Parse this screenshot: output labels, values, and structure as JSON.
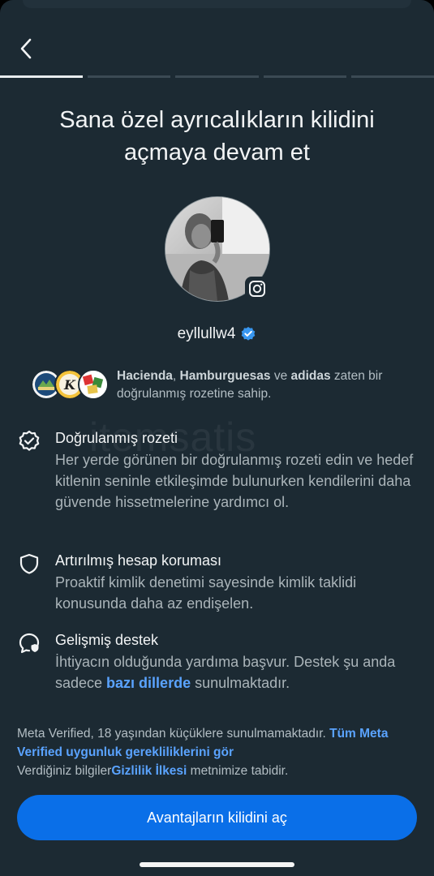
{
  "header": {
    "back_label": "Back",
    "progress": {
      "total_steps": 5,
      "current_step": 1
    }
  },
  "title_line1": "Sana özel ayrıcalıkların kilidini",
  "title_line2": "açmaya devam et",
  "profile": {
    "username": "eyllullw4",
    "verified": true,
    "platform_icon": "instagram-icon"
  },
  "brands": {
    "name1": "Hacienda",
    "sep": ", ",
    "name2": "Hamburguesas",
    "connector": " ve ",
    "name3": "adidas",
    "suffix": " zaten bir doğrulanmış rozetine sahip."
  },
  "features": [
    {
      "icon": "verified-badge-outline-icon",
      "title": "Doğrulanmış rozeti",
      "description": "Her yerde görünen bir doğrulanmış rozeti edin ve hedef kitlenin seninle etkileşimde bulunurken kendilerini daha güvende hissetmelerine yardımcı ol."
    },
    {
      "icon": "shield-icon",
      "title": "Artırılmış hesap koruması",
      "description": "Proaktif kimlik denetimi sayesinde kimlik taklidi konusunda daha az endişelen."
    },
    {
      "icon": "support-chat-icon",
      "title": "Gelişmiş destek",
      "description_prefix": "İhtiyacın olduğunda yardıma başvur. Destek şu anda sadece ",
      "description_link": "bazı dillerde",
      "description_suffix": " sunulmaktadır."
    }
  ],
  "footer": {
    "line1_text": "Meta Verified, 18 yaşından küçüklere sunulmamaktadır. ",
    "line1_link": "Tüm Meta Verified uygunluk gerekliliklerini gör",
    "line2_text": "Verdiğiniz bilgiler",
    "line2_link": "Gizlilik İlkesi",
    "line2_suffix": " metnimize tabidir."
  },
  "cta_label": "Avantajların kilidini aç",
  "watermark": "itemsatis",
  "colors": {
    "background": "#1c2a33",
    "accent": "#0a6fe8",
    "link": "#5aa3ff",
    "verified": "#3897f0"
  }
}
